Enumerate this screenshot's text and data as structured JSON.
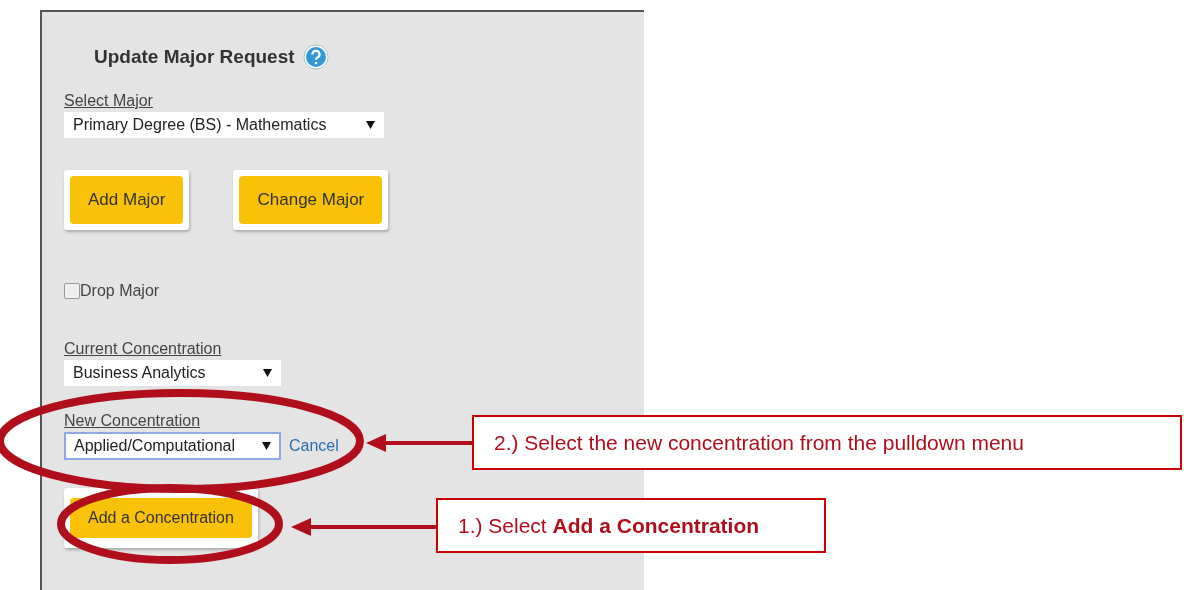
{
  "panel": {
    "title": "Update Major Request",
    "select_major": {
      "label": "Select Major",
      "value": "Primary Degree (BS) - Mathematics",
      "focused": false
    },
    "major_buttons": [
      "Add Major",
      "Change Major"
    ],
    "drop_major": {
      "label": "Drop Major",
      "checked": false
    },
    "current_concentration": {
      "label": "Current Concentration",
      "value": "Business Analytics",
      "focused": false
    },
    "new_concentration": {
      "label": "New Concentration",
      "value": "Applied/Computational",
      "focused": true,
      "link": "Cancel"
    },
    "add_button": "Add a Concentration"
  },
  "callouts": [
    {
      "text": "2.) Select the new concentration from the pulldown menu"
    },
    {
      "text": "1.) Select **Add a Concentration**"
    }
  ]
}
